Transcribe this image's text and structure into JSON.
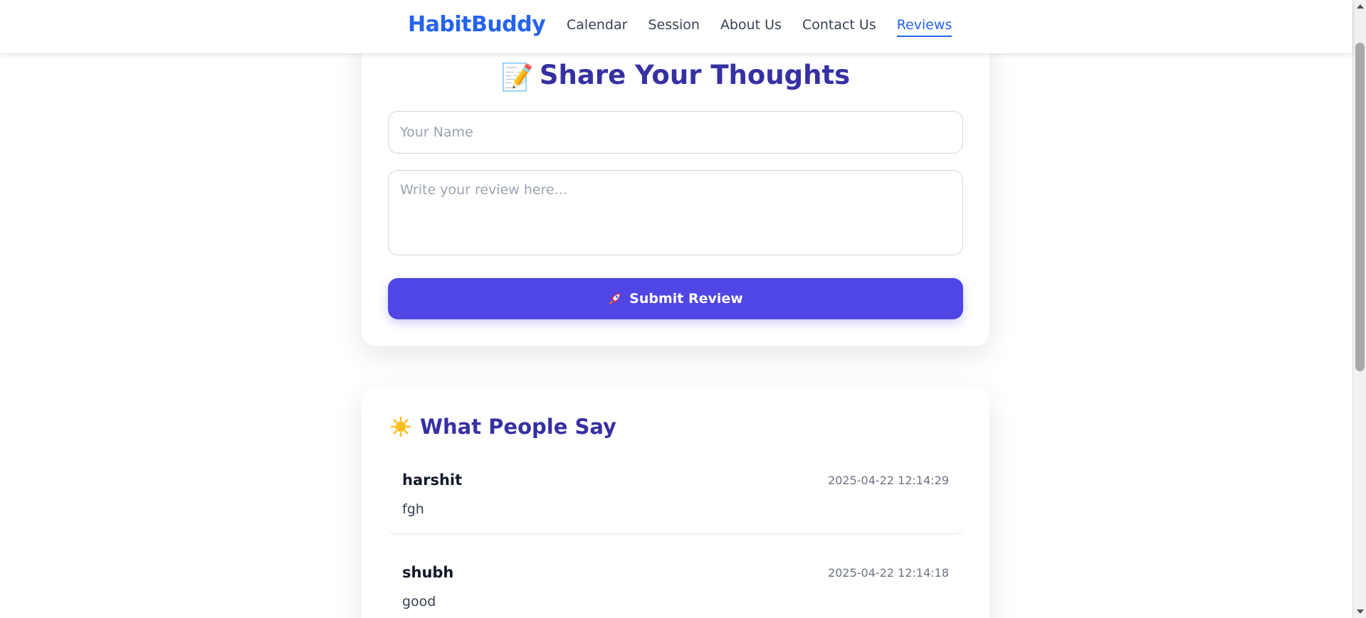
{
  "navbar": {
    "brand": "HabitBuddy",
    "links": [
      {
        "label": "Calendar"
      },
      {
        "label": "Session"
      },
      {
        "label": "About Us"
      },
      {
        "label": "Contact Us"
      },
      {
        "label": "Reviews",
        "active": true
      }
    ]
  },
  "review_form": {
    "title_emoji": "📝",
    "title": "Share Your Thoughts",
    "name_field": {
      "value": "",
      "placeholder": "Your Name"
    },
    "review_field": {
      "value": "",
      "placeholder": "Write your review here..."
    },
    "submit_icon": "rocket-icon",
    "submit_label": "Submit Review"
  },
  "reviews_section": {
    "icon": "sun-icon",
    "title": "What People Say",
    "reviews": [
      {
        "name": "harshit",
        "date": "2025-04-22 12:14:29",
        "text": "fgh"
      },
      {
        "name": "shubh",
        "date": "2025-04-22 12:14:18",
        "text": "good"
      }
    ]
  },
  "colors": {
    "brand": "#2563eb",
    "title": "#3730a3",
    "button": "#4f46e5",
    "active_link": "#2563eb"
  }
}
